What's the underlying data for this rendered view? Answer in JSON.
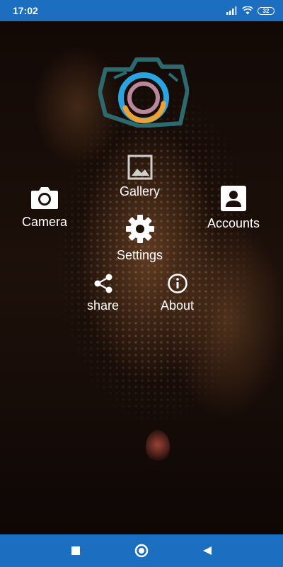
{
  "status_bar": {
    "time": "17:02",
    "battery": "32"
  },
  "menu": {
    "gallery": "Gallery",
    "camera": "Camera",
    "accounts": "Accounts",
    "settings": "Settings",
    "share": "share",
    "about": "About"
  },
  "icons": {
    "logo": "camera-logo-icon",
    "gallery": "image-icon",
    "camera": "camera-icon",
    "accounts": "account-box-icon",
    "settings": "gear-icon",
    "share": "share-icon",
    "about": "info-icon"
  },
  "colors": {
    "bar_blue": "#1c6fc0",
    "logo_teal": "#2d6a70",
    "ring_blue": "#2aa4e0",
    "ring_orange": "#f0a030",
    "ring_mauve": "#b9879a"
  }
}
